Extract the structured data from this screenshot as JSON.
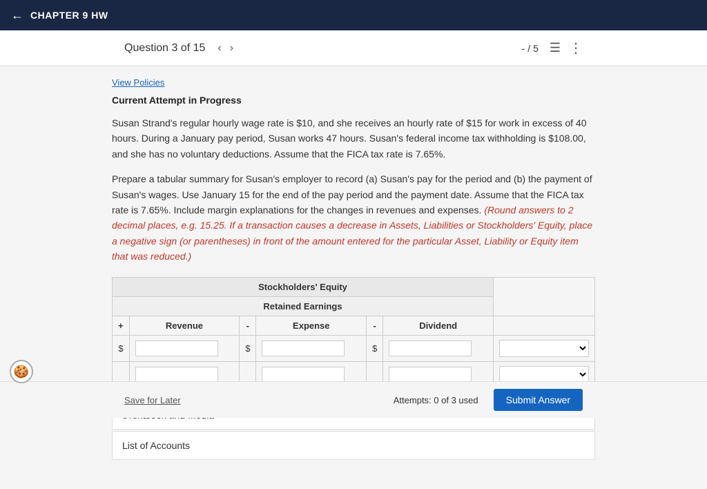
{
  "topNav": {
    "backLabel": "←",
    "chapterTitle": "CHAPTER 9 HW"
  },
  "questionNav": {
    "questionLabel": "Question 3 of 15",
    "prevArrow": "‹",
    "nextArrow": "›",
    "score": "- / 5",
    "listIcon": "☰",
    "moreIcon": "⋮"
  },
  "content": {
    "viewPolicies": "View Policies",
    "currentAttempt": "Current Attempt in Progress",
    "questionText": "Susan Strand's regular hourly wage rate is $10, and she receives an hourly rate of $15 for work in excess of 40 hours. During a January pay period, Susan works 47 hours. Susan's federal income tax withholding is $108.00, and she has no voluntary deductions. Assume that the FICA tax rate is 7.65%.",
    "instructions": "Prepare a tabular summary for Susan's employer to record (a) Susan's pay for the period and (b) the payment of Susan's wages. Use January 15 for the end of the pay period and the payment date. Assume that the FICA tax rate is 7.65%. Include margin explanations for the changes in revenues and expenses.",
    "roundNote": "(Round answers to 2 decimal places, e.g. 15.25. If a transaction causes a decrease in Assets, Liabilities or Stockholders' Equity, place a negative sign (or parentheses) in front of the amount entered for the particular Asset, Liability or Equity item that was reduced.)",
    "table": {
      "header1": "Stockholders' Equity",
      "header2": "Retained Earnings",
      "colPlus": "+",
      "colRevenue": "Revenue",
      "colMinusExpense": "-",
      "colExpense": "Expense",
      "colMinusDividend": "-",
      "colDividend": "Dividend",
      "currencySymbol": "$",
      "rows": [
        {
          "id": "row1",
          "col1": "",
          "col2": "",
          "col3": "",
          "dropdown": ""
        },
        {
          "id": "row2",
          "col1": "",
          "col2": "",
          "col3": "",
          "dropdown": ""
        }
      ]
    },
    "eTextbook": "eTextbook and Media",
    "listOfAccounts": "List of Accounts"
  },
  "footer": {
    "saveLater": "Save for Later",
    "attempts": "Attempts: 0 of 3 used",
    "submitButton": "Submit Answer"
  }
}
